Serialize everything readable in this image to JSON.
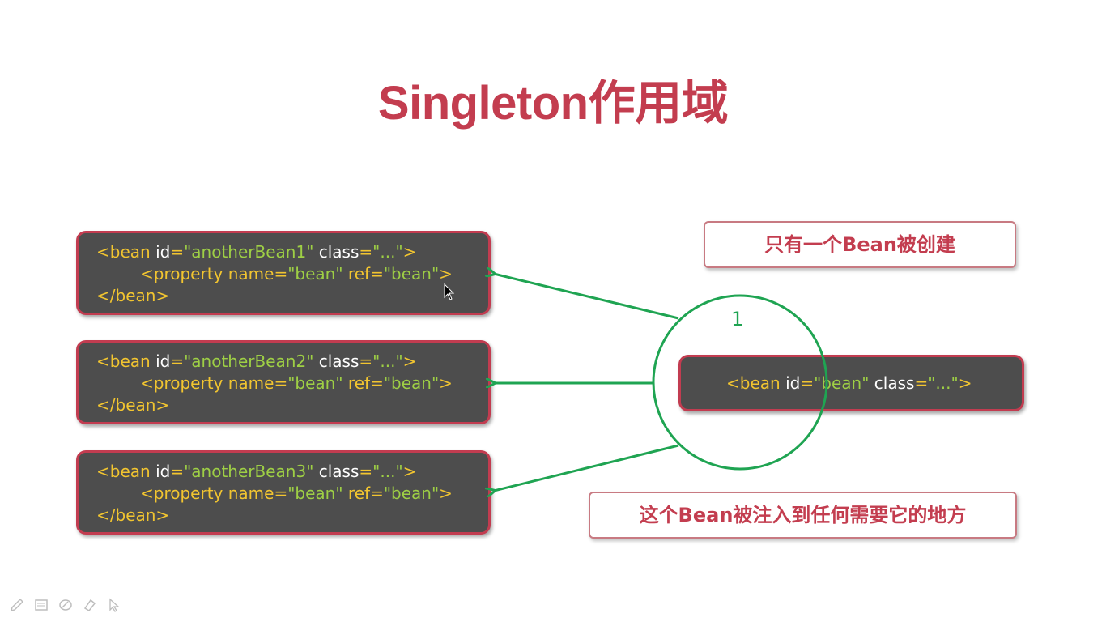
{
  "title": "Singleton作用域",
  "consumer_beans": [
    {
      "line1": {
        "tag": "<bean",
        "id_attr": "id",
        "id_eq": "=",
        "id_val": "\"anotherBean1\"",
        "class_attr": "class",
        "class_eq": "=",
        "class_val": "\"...\"",
        "close": ">"
      },
      "line2": {
        "tag": "<property",
        "name_attr": "name",
        "name_eq": "=",
        "name_val": "\"bean\"",
        "ref_attr": "ref",
        "ref_eq": "=",
        "ref_val": "\"bean\"",
        "close": ">"
      },
      "line3": "</bean>"
    },
    {
      "line1": {
        "tag": "<bean",
        "id_attr": "id",
        "id_eq": "=",
        "id_val": "\"anotherBean2\"",
        "class_attr": "class",
        "class_eq": "=",
        "class_val": "\"...\"",
        "close": ">"
      },
      "line2": {
        "tag": "<property",
        "name_attr": "name",
        "name_eq": "=",
        "name_val": "\"bean\"",
        "ref_attr": "ref",
        "ref_eq": "=",
        "ref_val": "\"bean\"",
        "close": ">"
      },
      "line3": "</bean>"
    },
    {
      "line1": {
        "tag": "<bean",
        "id_attr": "id",
        "id_eq": "=",
        "id_val": "\"anotherBean3\"",
        "class_attr": "class",
        "class_eq": "=",
        "class_val": "\"...\"",
        "close": ">"
      },
      "line2": {
        "tag": "<property",
        "name_attr": "name",
        "name_eq": "=",
        "name_val": "\"bean\"",
        "ref_attr": "ref",
        "ref_eq": "=",
        "ref_val": "\"bean\"",
        "close": ">"
      },
      "line3": "</bean>"
    }
  ],
  "singleton_bean": {
    "tag": "<bean",
    "id_attr": "id",
    "id_eq": "=",
    "id_val": "\"bean\"",
    "class_attr": "class",
    "class_eq": "=",
    "class_val": "\"...\"",
    "close": ">"
  },
  "count_label": "1",
  "callout_top": "只有一个Bean被创建",
  "callout_bottom": "这个Bean被注入到任何需要它的地方",
  "colors": {
    "title": "#c33d4f",
    "box_border": "#c23c50",
    "box_fill": "#4d4d4d",
    "tag_text": "#f2c530",
    "string_text": "#9ecf45",
    "arrow_green": "#1fa452"
  },
  "toolbar": {
    "icons": [
      "pen-icon",
      "board-icon",
      "eraser-icon",
      "highlighter-icon",
      "pointer-icon"
    ]
  }
}
